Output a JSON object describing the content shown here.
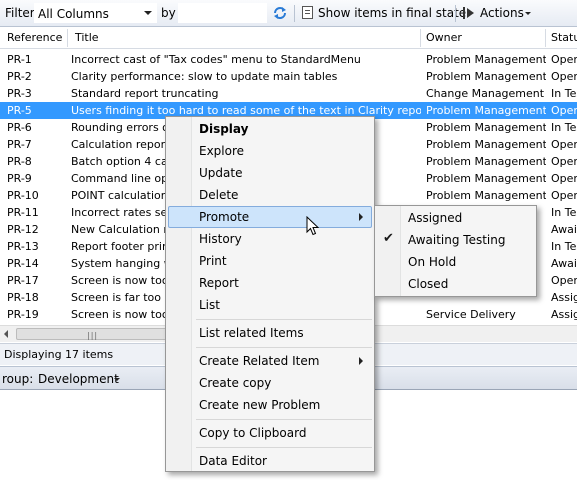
{
  "toolbar": {
    "filter_label": "Filter",
    "filter_value": "All Columns",
    "by_label": "by",
    "by_value": "",
    "show_final_label": "Show items in final state",
    "actions_label": "Actions"
  },
  "columns": [
    "Reference",
    "Title",
    "Owner",
    "Status"
  ],
  "rows": [
    {
      "ref": "PR-1",
      "title": "Incorrect cast of \"Tax codes\" menu to StandardMenu",
      "owner": "Problem Management",
      "status": "Open"
    },
    {
      "ref": "PR-2",
      "title": "Clarity performance: slow to update main tables",
      "owner": "Problem Management",
      "status": "Open"
    },
    {
      "ref": "PR-3",
      "title": "Standard report truncating",
      "owner": "Change Management",
      "status": "In Test"
    },
    {
      "ref": "PR-5",
      "title": "Users finding it too hard to read some of the text in Clarity reports",
      "owner": "Problem Management",
      "status": "Open"
    },
    {
      "ref": "PR-6",
      "title": "Rounding errors o",
      "owner": "Problem Management",
      "status": "In Test"
    },
    {
      "ref": "PR-7",
      "title": "Calculation report",
      "owner": "Problem Management",
      "status": "Open"
    },
    {
      "ref": "PR-8",
      "title": "Batch option 4 cau",
      "owner": "Problem Management",
      "status": "Open"
    },
    {
      "ref": "PR-9",
      "title": "Command line opt                                           ion",
      "owner": "Problem Management",
      "status": "Open"
    },
    {
      "ref": "PR-10",
      "title": "POINT calculation",
      "owner": "Problem Management",
      "status": "Open"
    },
    {
      "ref": "PR-11",
      "title": "Incorrect rates set",
      "owner": "",
      "status": "In Test"
    },
    {
      "ref": "PR-12",
      "title": "New Calculation re",
      "owner": "",
      "status": "Awaiting"
    },
    {
      "ref": "PR-13",
      "title": "Report footer prin",
      "owner": "",
      "status": "In Test"
    },
    {
      "ref": "PR-14",
      "title": "System hanging w",
      "owner": "",
      "status": "Awaiting"
    },
    {
      "ref": "PR-17",
      "title": "Screen is now too",
      "owner": "",
      "status": "Open"
    },
    {
      "ref": "PR-18",
      "title": "Screen is far too b",
      "owner": "",
      "status": "Assigned"
    },
    {
      "ref": "PR-19",
      "title": "Screen is now too",
      "owner": "Service Delivery",
      "status": "Assigned"
    }
  ],
  "selected_row": "PR-5",
  "status_text": "Displaying 17 items",
  "group": {
    "label": "roup:",
    "value": "Development"
  },
  "context_menu": {
    "items": [
      "Display",
      "Explore",
      "Update",
      "Delete",
      "Promote",
      "History",
      "Print",
      "Report",
      "List",
      "List related Items",
      "Create Related Item",
      "Create copy",
      "Create new Problem",
      "Copy to Clipboard",
      "Data Editor"
    ],
    "highlighted": "Promote"
  },
  "submenu": {
    "items": [
      "Assigned",
      "Awaiting Testing",
      "On Hold",
      "Closed"
    ],
    "checked": "Awaiting Testing"
  },
  "colors": {
    "selection": "#3399ff",
    "menu_highlight": "#cde4fb",
    "refresh_icon": "#2a7bd6"
  }
}
